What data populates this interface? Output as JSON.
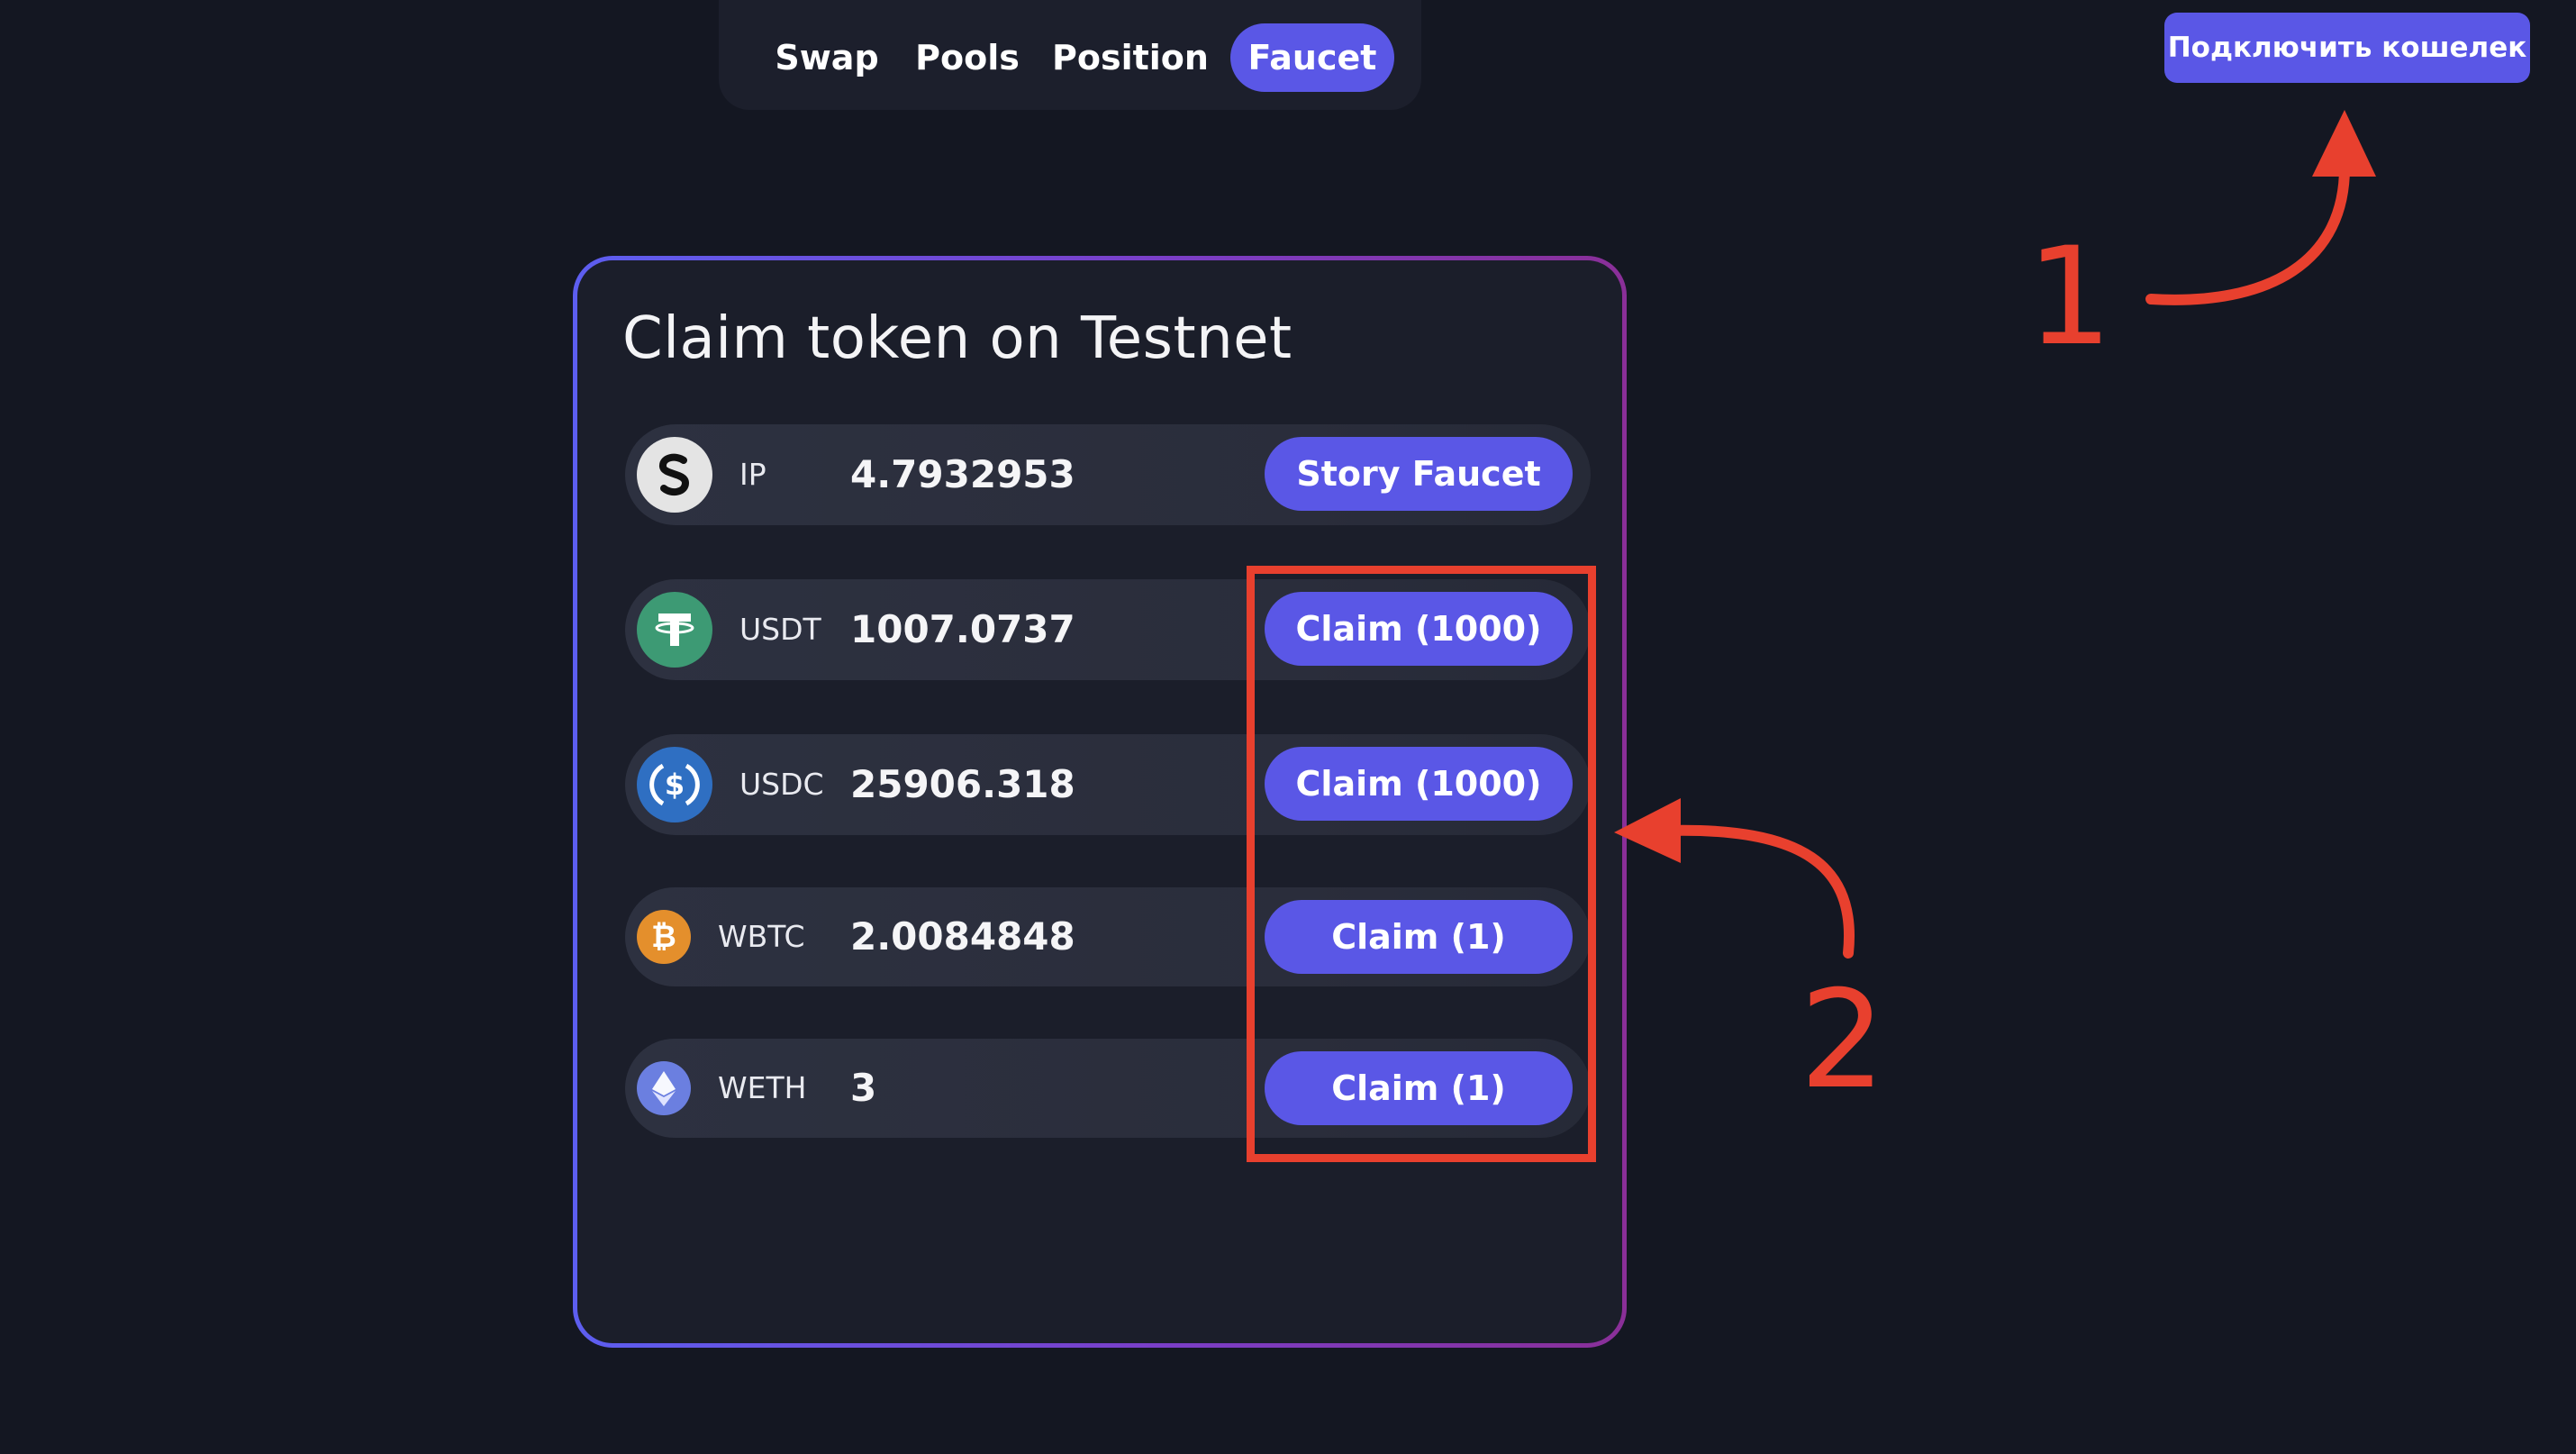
{
  "nav": {
    "items": [
      {
        "label": "Swap"
      },
      {
        "label": "Pools"
      },
      {
        "label": "Position"
      },
      {
        "label": "Faucet"
      }
    ],
    "active": "Faucet"
  },
  "header": {
    "connect_wallet_label": "Подключить кошелек"
  },
  "card": {
    "title": "Claim token on Testnet",
    "tokens": [
      {
        "symbol": "IP",
        "balance": "4.7932953",
        "action_label": "Story Faucet",
        "icon": "story-logo-icon",
        "icon_color": "#e6e6e6"
      },
      {
        "symbol": "USDT",
        "balance": "1007.0737",
        "action_label": "Claim (1000)",
        "icon": "tether-icon",
        "icon_color": "#3d9a74"
      },
      {
        "symbol": "USDC",
        "balance": "25906.318",
        "action_label": "Claim (1000)",
        "icon": "usdc-icon",
        "icon_color": "#2f6fc2"
      },
      {
        "symbol": "WBTC",
        "balance": "2.0084848",
        "action_label": "Claim (1)",
        "icon": "bitcoin-icon",
        "icon_color": "#e48f2c"
      },
      {
        "symbol": "WETH",
        "balance": "3",
        "action_label": "Claim (1)",
        "icon": "ethereum-icon",
        "icon_color": "#6b7fe0"
      }
    ]
  },
  "annotations": {
    "marker_1": "1",
    "marker_2": "2",
    "color": "#e8402e"
  },
  "colors": {
    "accent": "#5a57e6",
    "background": "#141722",
    "card_border_start": "#5d5ef0",
    "card_border_end": "#8a2f98"
  }
}
